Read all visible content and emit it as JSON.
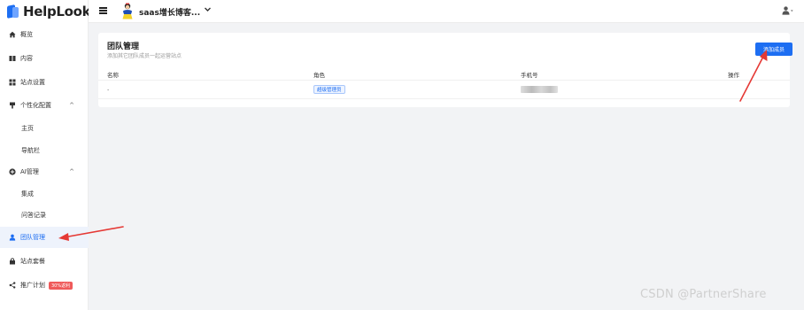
{
  "app": {
    "name": "HelpLook"
  },
  "header": {
    "site_name": "saas增长博客...",
    "site_chevron": "⌄",
    "user_icon": "user-icon"
  },
  "sidebar": {
    "items": [
      {
        "label": "概览",
        "icon": "home-icon"
      },
      {
        "label": "内容",
        "icon": "book-icon"
      },
      {
        "label": "站点设置",
        "icon": "grid-icon"
      },
      {
        "label": "个性化配置",
        "icon": "brush-icon",
        "expanded": true
      },
      {
        "label": "主页"
      },
      {
        "label": "导航栏"
      },
      {
        "label": "AI管理",
        "icon": "plus-circle-icon",
        "expanded": true
      },
      {
        "label": "集成"
      },
      {
        "label": "问答记录"
      },
      {
        "label": "团队管理",
        "icon": "user-icon",
        "active": true
      },
      {
        "label": "站点套餐",
        "icon": "bag-icon"
      },
      {
        "label": "推广计划",
        "icon": "share-icon",
        "badge": "30%返利"
      }
    ]
  },
  "main": {
    "title": "团队管理",
    "subtitle": "添加其它团队成员一起运营站点",
    "add_button": "添加成员",
    "table": {
      "headers": [
        "名称",
        "角色",
        "手机号",
        "操作"
      ],
      "rows": [
        {
          "name": "-",
          "role": "超级管理员",
          "phone": "",
          "action": ""
        }
      ]
    }
  },
  "watermark": "CSDN @PartnerShare",
  "colors": {
    "accent": "#1d6ef2",
    "annotation": "#e53935",
    "badge": "#ef5a5a"
  }
}
